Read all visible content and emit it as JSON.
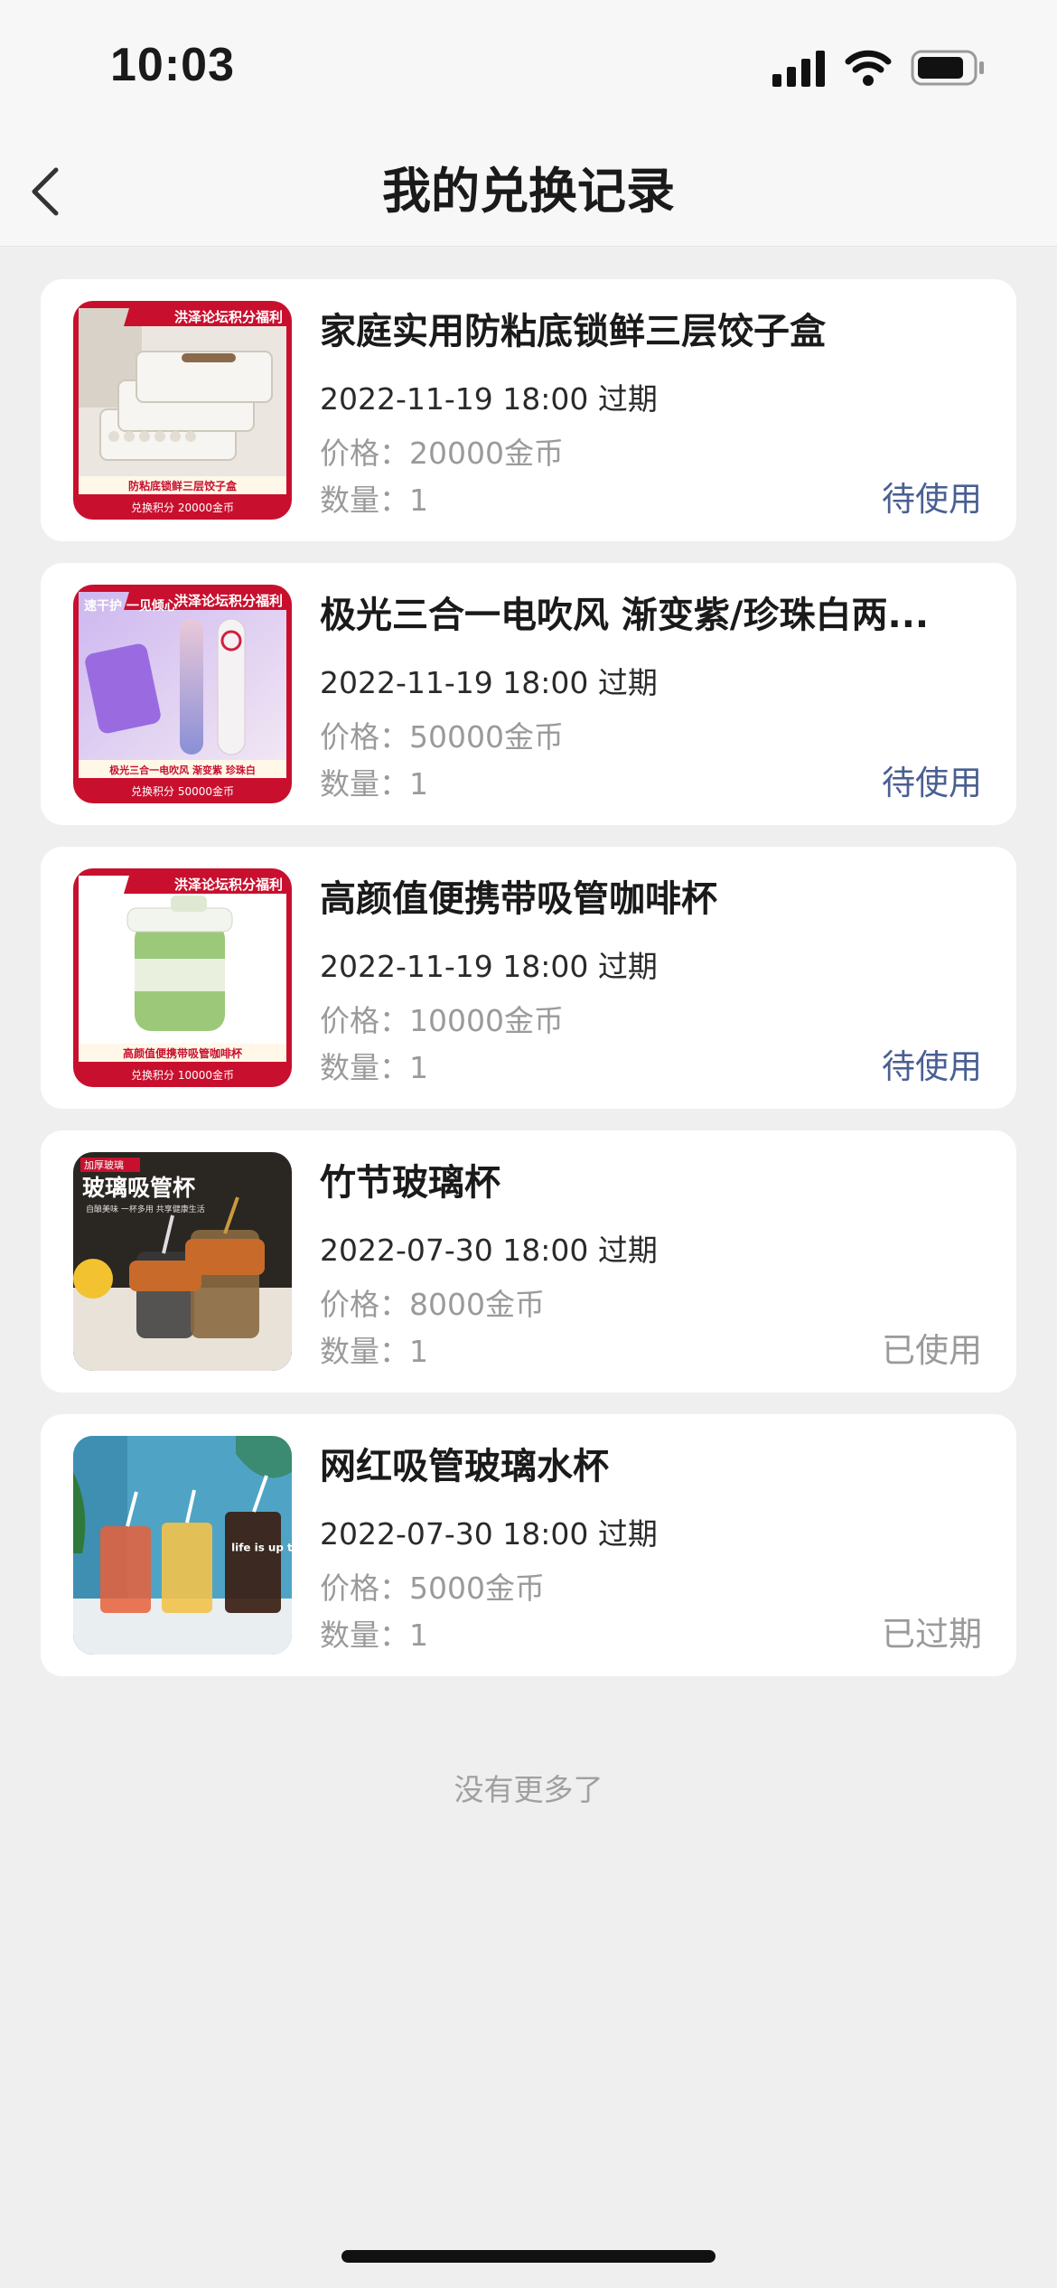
{
  "status_bar": {
    "time": "10:03"
  },
  "header": {
    "title": "我的兑换记录"
  },
  "items": [
    {
      "title": "家庭实用防粘底锁鲜三层饺子盒",
      "expiry": "2022-11-19 18:00 过期",
      "price": "价格：20000金币",
      "quantity": "数量：1",
      "status": "待使用",
      "thumb": {
        "banner": "洪泽论坛积分福利",
        "caption": "防粘底锁鲜三层饺子盒",
        "points": "兑换积分 20000金币"
      }
    },
    {
      "title": "极光三合一电吹风 渐变紫/珍珠白两...",
      "expiry": "2022-11-19 18:00 过期",
      "price": "价格：50000金币",
      "quantity": "数量：1",
      "status": "待使用",
      "thumb": {
        "banner": "洪泽论坛积分福利",
        "caption": "极光三合一电吹风 渐变紫 珍珠白",
        "points": "兑换积分 50000金币",
        "side_text": "速干护 一见倾心"
      }
    },
    {
      "title": "高颜值便携带吸管咖啡杯",
      "expiry": "2022-11-19 18:00 过期",
      "price": "价格：10000金币",
      "quantity": "数量：1",
      "status": "待使用",
      "thumb": {
        "banner": "洪泽论坛积分福利",
        "caption": "高颜值便携带吸管咖啡杯",
        "points": "兑换积分 10000金币"
      }
    },
    {
      "title": "竹节玻璃杯",
      "expiry": "2022-07-30 18:00 过期",
      "price": "价格：8000金币",
      "quantity": "数量：1",
      "status": "已使用",
      "thumb": {
        "tag": "加厚玻璃",
        "headline": "玻璃吸管杯",
        "subline": "自酿美味 一杯多用 共享健康生活"
      }
    },
    {
      "title": "网红吸管玻璃水杯",
      "expiry": "2022-07-30 18:00 过期",
      "price": "价格：5000金币",
      "quantity": "数量：1",
      "status": "已过期",
      "thumb": {
        "cup_text": "life is up to me"
      }
    }
  ],
  "footer": {
    "no_more": "没有更多了"
  },
  "colors": {
    "background": "#efefef",
    "card": "#ffffff",
    "status_pending": "#4a5f92",
    "status_inactive": "#9a9a9a",
    "promo_red": "#c8102e"
  }
}
